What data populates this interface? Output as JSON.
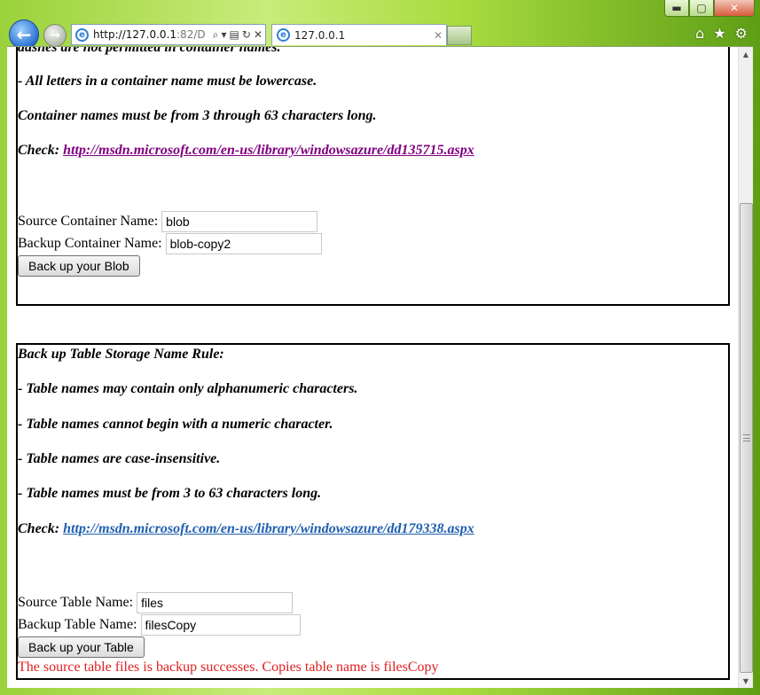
{
  "browser": {
    "address_host": "http://127.0.0.1",
    "address_path": ":82/D",
    "tab_title": "127.0.0.1",
    "window_buttons": {
      "minimize": "▬",
      "maximize": "▢",
      "close": "✕"
    }
  },
  "blob_section": {
    "rules": [
      "dashes are not permitted in container names.",
      "- All letters in a container name must be lowercase.",
      "Container names must be from 3 through 63 characters long."
    ],
    "check_label": "Check:",
    "check_link": "http://msdn.microsoft.com/en-us/library/windowsazure/dd135715.aspx",
    "source_label": "Source Container Name:",
    "source_value": "blob",
    "backup_label": "Backup Container Name:",
    "backup_value": "blob-copy2",
    "button_label": "Back up your Blob"
  },
  "table_section": {
    "heading": "Back up Table Storage Name Rule:",
    "rules": [
      "- Table names may contain only alphanumeric characters.",
      "- Table names cannot begin with a numeric character.",
      "- Table names are case-insensitive.",
      "- Table names must be from 3 to 63 characters long."
    ],
    "check_label": "Check:",
    "check_link": "http://msdn.microsoft.com/en-us/library/windowsazure/dd179338.aspx",
    "source_label": "Source Table Name:",
    "source_value": "files",
    "backup_label": "Backup Table Name:",
    "backup_value": "filesCopy",
    "button_label": "Back up your Table",
    "status_message": "The source table files is backup successes. Copies table name is filesCopy"
  },
  "colors": {
    "visited_link": "#800080",
    "link": "#1f5fb0",
    "status": "#e02020"
  }
}
